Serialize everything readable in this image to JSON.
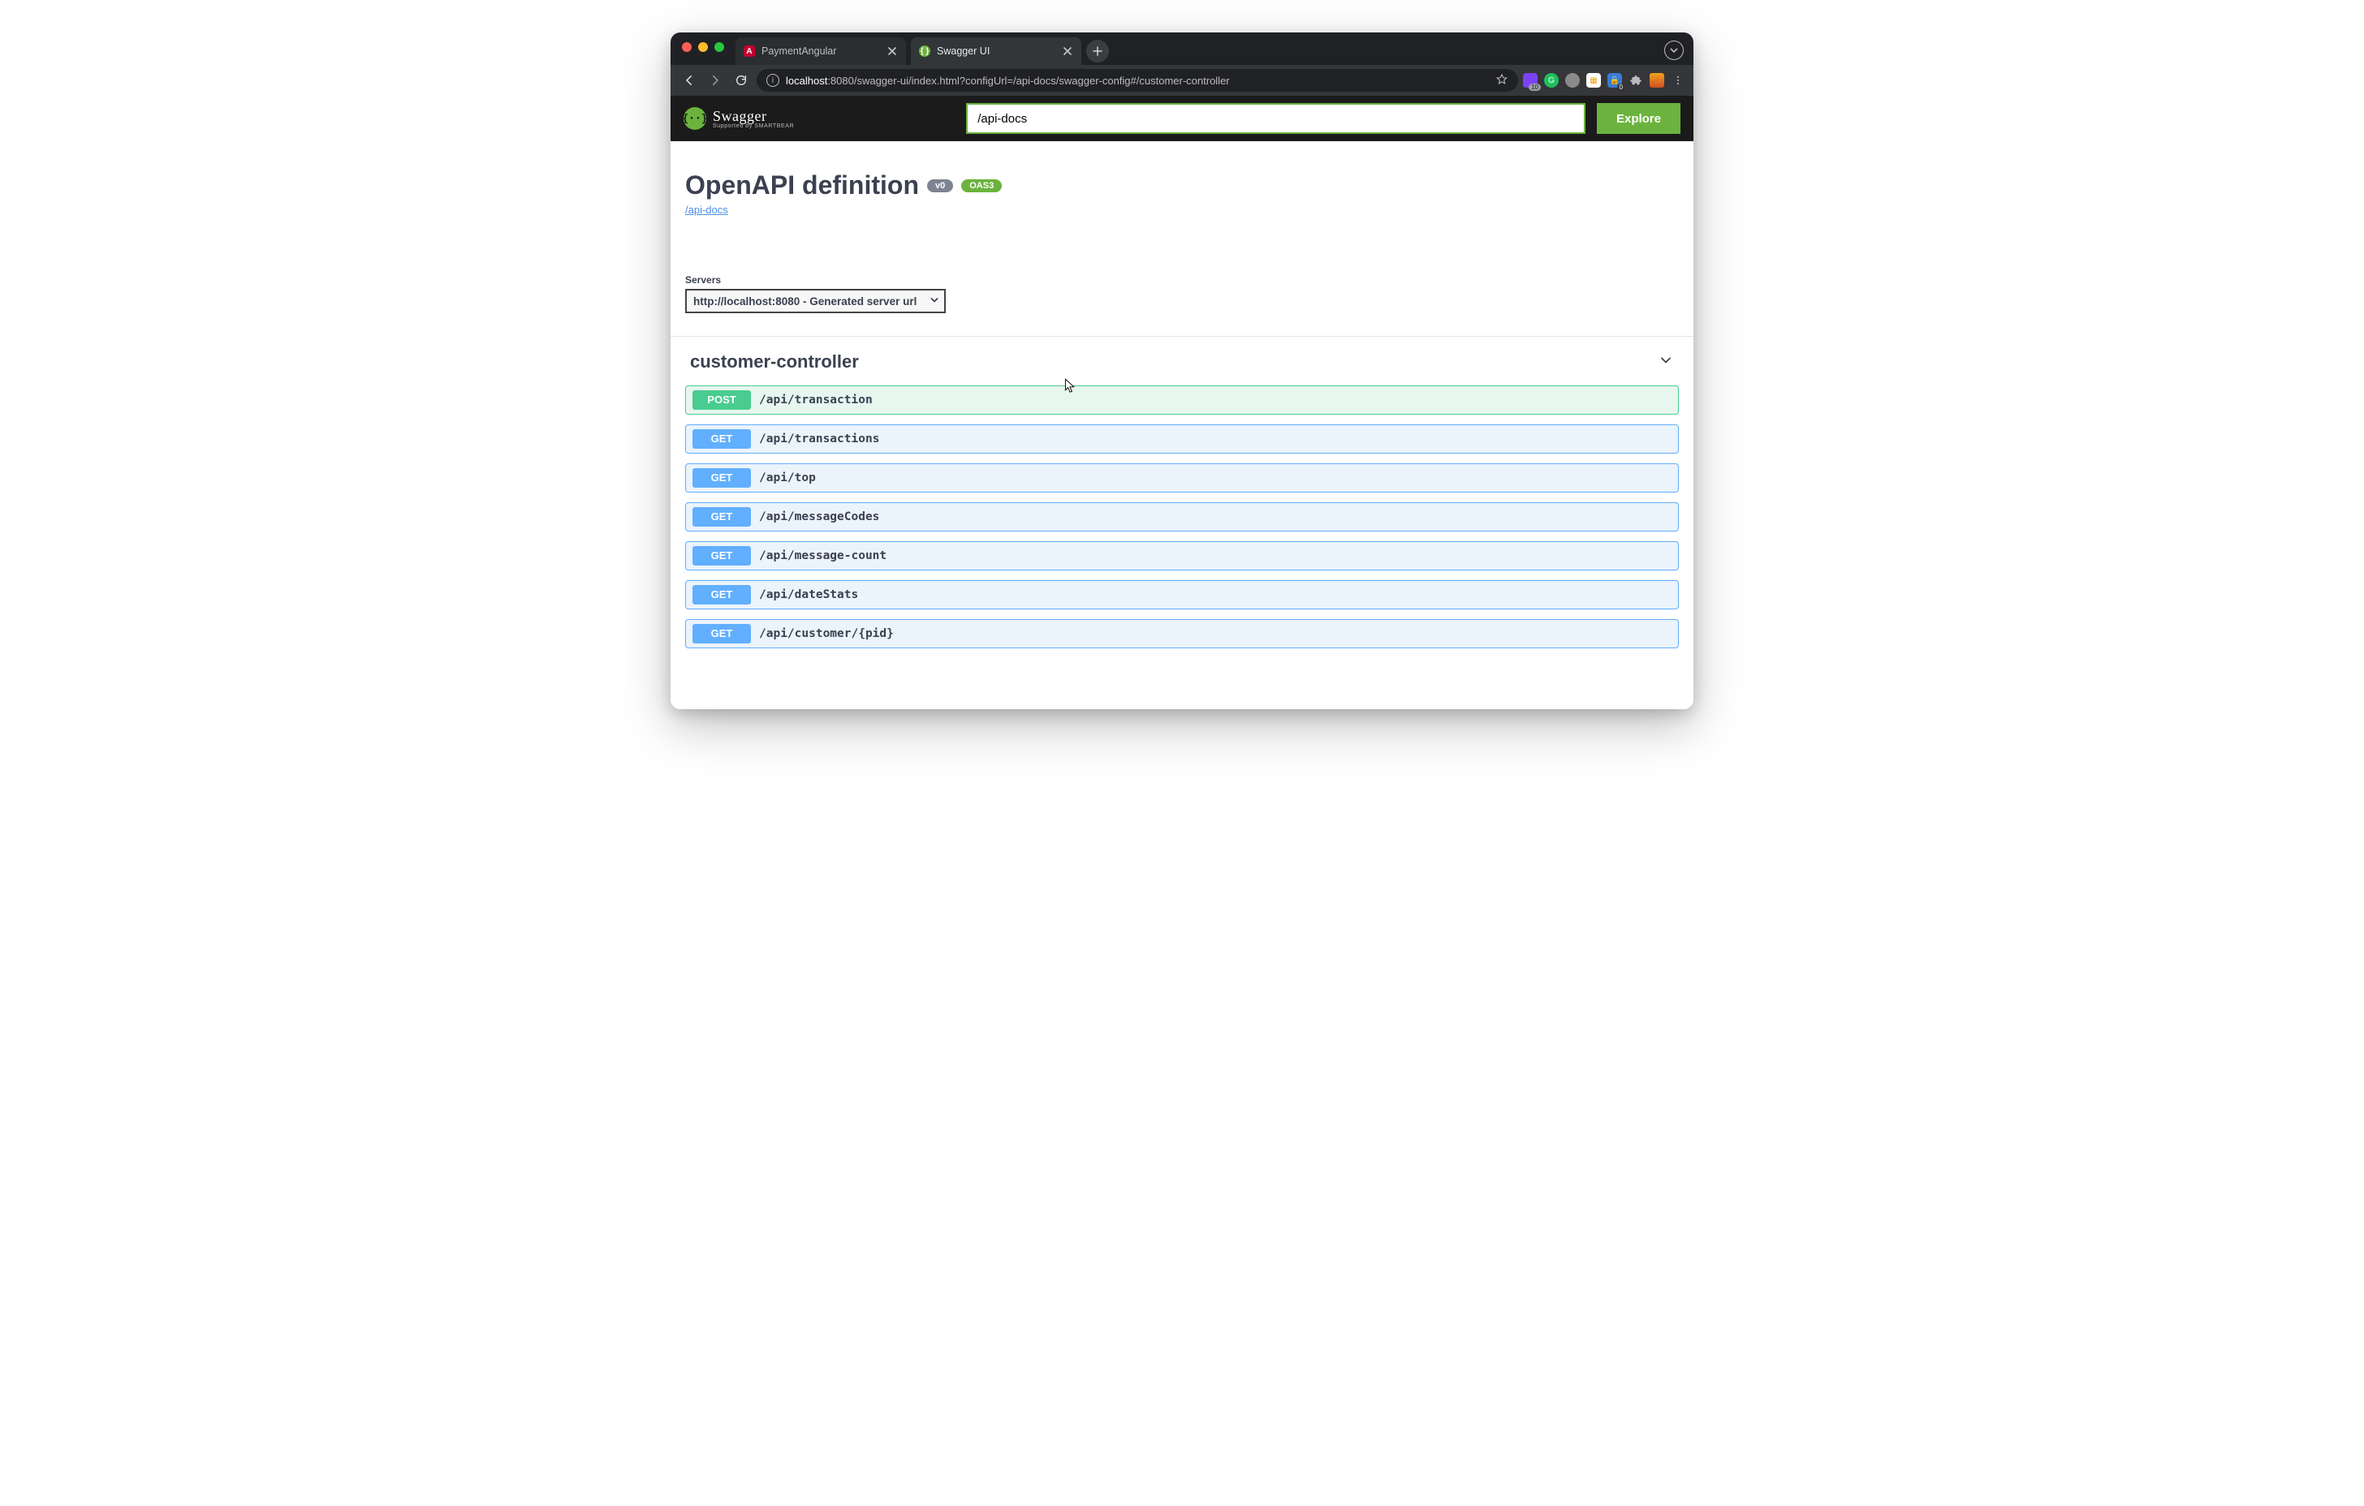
{
  "browser": {
    "tabs": [
      {
        "title": "PaymentAngular",
        "active": false,
        "favicon": "angular"
      },
      {
        "title": "Swagger UI",
        "active": true,
        "favicon": "swagger"
      }
    ],
    "url_host": "localhost",
    "url_path": ":8080/swagger-ui/index.html?configUrl=/api-docs/swagger-config#/customer-controller",
    "ext_badges": {
      "purple": "10",
      "shield": "0"
    }
  },
  "topbar": {
    "brand": "Swagger",
    "brand_sub": "Supported by SMARTBEAR",
    "url_value": "/api-docs",
    "explore": "Explore"
  },
  "info": {
    "title": "OpenAPI definition",
    "version_badge": "v0",
    "oas_badge": "OAS3",
    "docs_link": "/api-docs"
  },
  "servers": {
    "label": "Servers",
    "selected": "http://localhost:8080 - Generated server url"
  },
  "tag": {
    "name": "customer-controller",
    "expanded": true
  },
  "operations": [
    {
      "method": "POST",
      "path": "/api/transaction"
    },
    {
      "method": "GET",
      "path": "/api/transactions"
    },
    {
      "method": "GET",
      "path": "/api/top"
    },
    {
      "method": "GET",
      "path": "/api/messageCodes"
    },
    {
      "method": "GET",
      "path": "/api/message-count"
    },
    {
      "method": "GET",
      "path": "/api/dateStats"
    },
    {
      "method": "GET",
      "path": "/api/customer/{pid}"
    }
  ]
}
